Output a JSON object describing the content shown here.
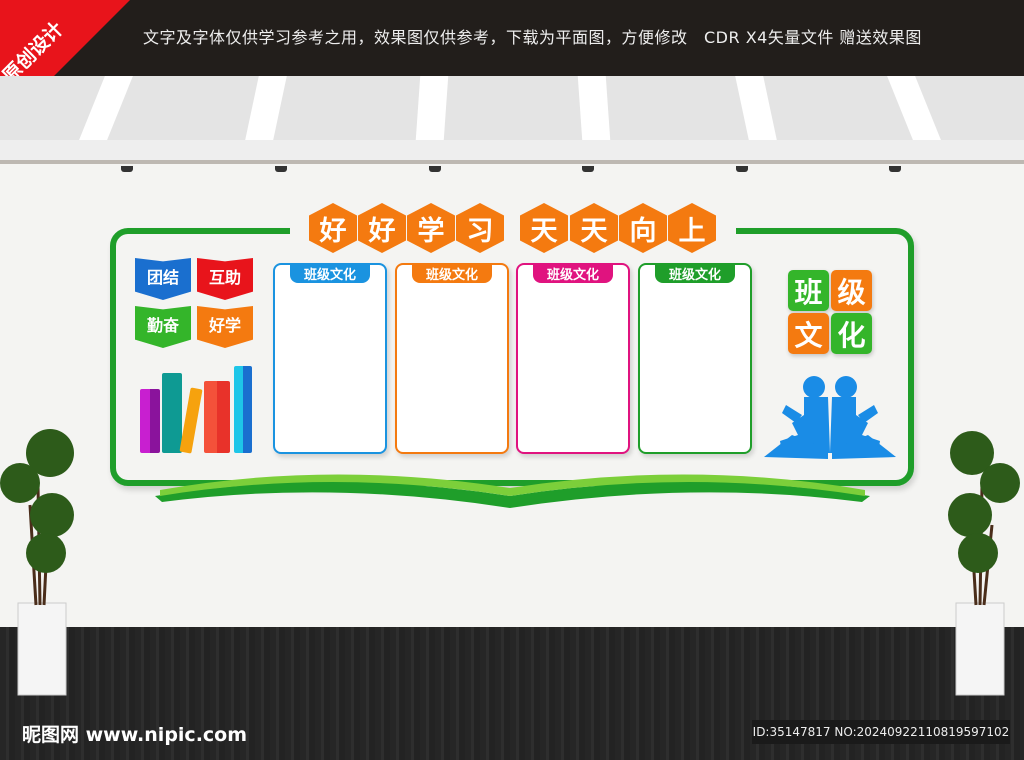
{
  "banner": {
    "corner_label": "原创设计",
    "notice": "文字及字体仅供学习参考之用，效果图仅供参考，下载为平面图，方便修改　CDR X4矢量文件  赠送效果图"
  },
  "title_chars": [
    "好",
    "好",
    "学",
    "习",
    "天",
    "天",
    "向",
    "上"
  ],
  "book_labels": [
    {
      "text": "团结",
      "color": "#1a6fcf"
    },
    {
      "text": "互助",
      "color": "#e8141b"
    },
    {
      "text": "勤奋",
      "color": "#34b52a"
    },
    {
      "text": "好学",
      "color": "#f47a10"
    }
  ],
  "panels": [
    {
      "tab": "班级文化",
      "color": "#1a93e0"
    },
    {
      "tab": "班级文化",
      "color": "#f47a10"
    },
    {
      "tab": "班级文化",
      "color": "#e0137f"
    },
    {
      "tab": "班级文化",
      "color": "#1f9e2a"
    }
  ],
  "tiles": [
    {
      "text": "班",
      "color": "#34b52a"
    },
    {
      "text": "级",
      "color": "#f47a10"
    },
    {
      "text": "文",
      "color": "#f47a10"
    },
    {
      "text": "化",
      "color": "#34b52a"
    }
  ],
  "footer": {
    "logo": "昵图网 www.nipic.com",
    "id": "ID:35147817 NO:20240922110819597102"
  }
}
